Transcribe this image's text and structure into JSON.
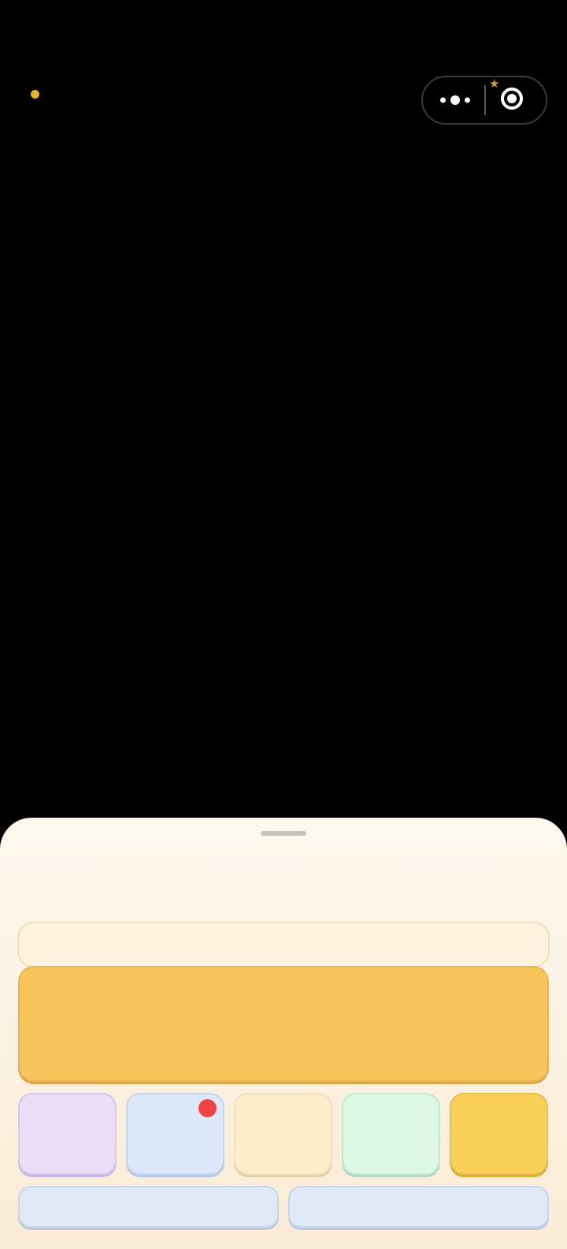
{
  "colors": {
    "status_dot": "#e6b52e",
    "capsule_divider": "#555555",
    "star_badge": "#c8a23a",
    "info_bar": "#fdf3df",
    "hero_card": "#f8c55c",
    "tiles": [
      "#eaddf7",
      "#dbe8fa",
      "#fdedc8",
      "#dcf7e2",
      "#f9d15a"
    ],
    "notify_dot": "#ee4444",
    "wide_buttons": "#e0e9f7"
  },
  "icons": {
    "status": "status-dot",
    "more": "more-dots-icon",
    "close": "close-target-icon",
    "badge": "star-icon"
  },
  "capsule": {
    "star_glyph": "★"
  }
}
